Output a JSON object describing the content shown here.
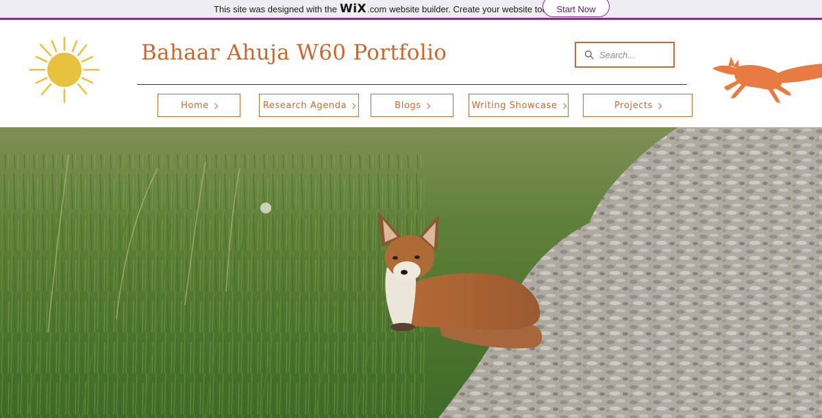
{
  "wix_banner": {
    "text_before": "This site was designed with the",
    "logo": "WiX",
    "domain": ".com",
    "text_after": "website builder. Create your website today.",
    "cta_label": "Start Now",
    "accent_color": "#7d2f8c"
  },
  "header": {
    "site_title": "Bahaar Ahuja W60 Portfolio",
    "title_color": "#c9682e",
    "search": {
      "placeholder": "Search...",
      "value": "",
      "icon": "search-icon"
    },
    "decorations": {
      "left_icon": "sun-icon",
      "right_icon": "fox-icon",
      "sun_color": "#e8c23e",
      "fox_color": "#e87b42"
    }
  },
  "nav": {
    "items": [
      {
        "label": "Home",
        "icon": "chevron-right-icon"
      },
      {
        "label": "Research Agenda",
        "icon": "chevron-right-icon"
      },
      {
        "label": "Blogs",
        "icon": "chevron-right-icon"
      },
      {
        "label": "Writing Showcase",
        "icon": "chevron-right-icon"
      },
      {
        "label": "Projects",
        "icon": "chevron-right-icon"
      }
    ],
    "border_color": "#c56a35"
  },
  "hero": {
    "image_subject": "fox-kit-on-gravel-path-photo"
  }
}
